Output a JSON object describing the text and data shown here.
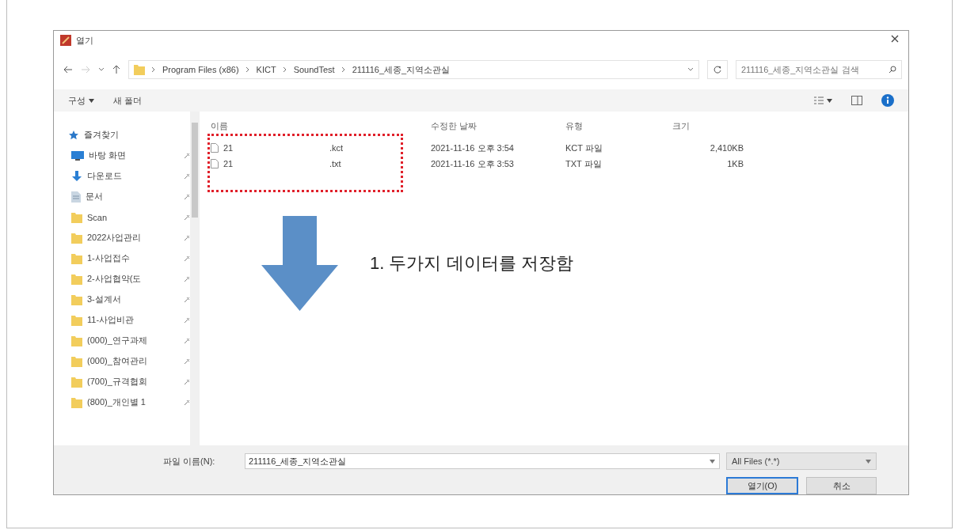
{
  "window": {
    "title": "열기"
  },
  "address_bar": {
    "path": [
      "Program Files (x86)",
      "KICT",
      "SoundTest",
      "211116_세종_지역소관실"
    ]
  },
  "search": {
    "placeholder": "211116_세종_지역소관실 검색"
  },
  "toolbar": {
    "buttons": [
      {
        "label": "구성",
        "kind": "menu"
      },
      {
        "label": "새 폴더",
        "kind": "plain"
      }
    ]
  },
  "sidebar": {
    "items": [
      {
        "label": "즐겨찾기",
        "kind": "star",
        "pinned": false
      },
      {
        "label": "바탕 화면",
        "kind": "desktop",
        "pinned": true
      },
      {
        "label": "다운로드",
        "kind": "download",
        "pinned": true
      },
      {
        "label": "문서",
        "kind": "document",
        "pinned": true
      },
      {
        "label": "Scan",
        "kind": "folder",
        "pinned": true
      },
      {
        "label": "2022사업관리",
        "kind": "folder",
        "pinned": true
      },
      {
        "label": "1-사업접수",
        "kind": "folder",
        "pinned": true
      },
      {
        "label": "2-사업협약(도",
        "kind": "folder",
        "pinned": true
      },
      {
        "label": "3-설계서",
        "kind": "folder",
        "pinned": true
      },
      {
        "label": "11-사업비관",
        "kind": "folder",
        "pinned": true
      },
      {
        "label": "(000)_연구과제",
        "kind": "folder",
        "pinned": true
      },
      {
        "label": "(000)_참여관리",
        "kind": "folder",
        "pinned": true
      },
      {
        "label": "(700)_규격협회",
        "kind": "folder",
        "pinned": true
      },
      {
        "label": "(800)_개인별 1",
        "kind": "folder",
        "pinned": true
      }
    ]
  },
  "table": {
    "columns": [
      "이름",
      "수정한 날짜",
      "유형",
      "크기"
    ],
    "rows": [
      {
        "name": "21",
        "extension": ".kct",
        "modified": "2021-11-16 오후 3:54",
        "type": "KCT 파일",
        "size": "2,410KB"
      },
      {
        "name": "21",
        "extension": ".txt",
        "modified": "2021-11-16 오후 3:53",
        "type": "TXT 파일",
        "size": "1KB"
      }
    ]
  },
  "annotation": {
    "text": "1.  두가지 데이터를 저장함"
  },
  "file_name": {
    "label": "파일 이름(N):",
    "value": "211116_세종_지역소관실"
  },
  "file_type": {
    "value": "All Files (*.*)"
  },
  "buttons": [
    {
      "label": "열기(O)",
      "kind": "primary"
    },
    {
      "label": "취소",
      "kind": "default"
    }
  ]
}
